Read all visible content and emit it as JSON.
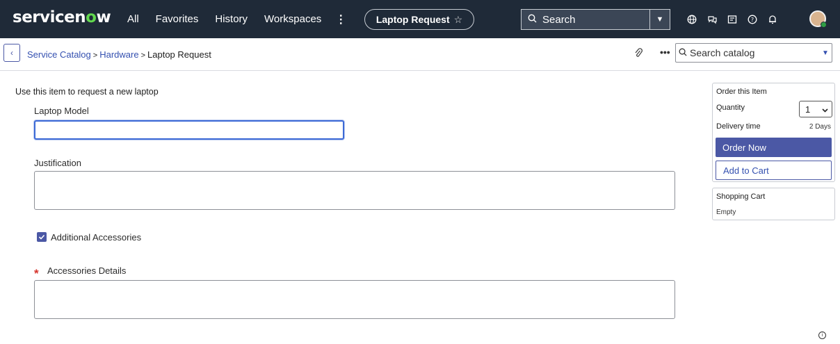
{
  "nav": {
    "logo_prefix": "servicen",
    "logo_o": "o",
    "logo_suffix": "w",
    "links": [
      "All",
      "Favorites",
      "History",
      "Workspaces"
    ],
    "more_icon": "⋮",
    "current_pill": "Laptop Request",
    "star_icon": "☆",
    "search_placeholder": "Search",
    "icons": [
      "globe-icon",
      "chat-icon",
      "inbox-icon",
      "help-icon",
      "bell-icon"
    ]
  },
  "subheader": {
    "back_icon": "‹",
    "breadcrumb": [
      "Service Catalog",
      "Hardware",
      "Laptop Request"
    ],
    "breadcrumb_sep": ">",
    "catalog_search_placeholder": "Search catalog"
  },
  "form": {
    "intro": "Use this item to request a new laptop",
    "laptop_model_label": "Laptop Model",
    "laptop_model_value": "",
    "justification_label": "Justification",
    "justification_value": "",
    "accessories_checkbox_label": "Additional Accessories",
    "accessories_checked": true,
    "required_marker": "*",
    "accessories_details_label": "Accessories Details",
    "accessories_details_value": ""
  },
  "order_panel": {
    "title": "Order this Item",
    "quantity_label": "Quantity",
    "quantity_value": "1",
    "delivery_label": "Delivery time",
    "delivery_value": "2 Days",
    "order_now": "Order Now",
    "add_to_cart": "Add to Cart"
  },
  "cart": {
    "title": "Shopping Cart",
    "status": "Empty"
  },
  "colors": {
    "nav_bg": "#1f2a38",
    "accent": "#4b58a5",
    "link": "#3450b0",
    "required": "#d6332b",
    "logo_green": "#62d84e"
  }
}
